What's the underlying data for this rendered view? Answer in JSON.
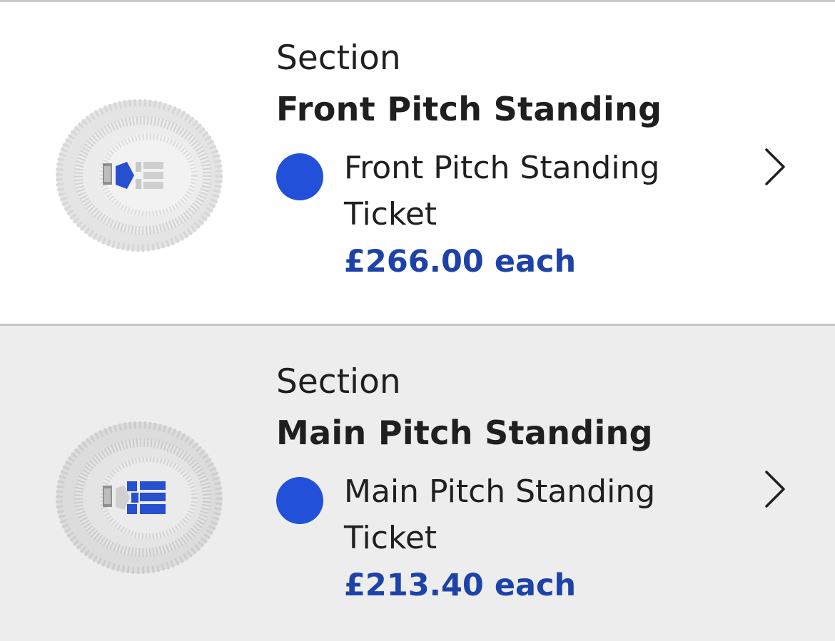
{
  "sections": [
    {
      "label": "Section",
      "name": "Front Pitch Standing",
      "ticket_name": "Front Pitch Standing Ticket",
      "price": "£266.00 each",
      "highlight": "front",
      "dot_color": "#2250d9",
      "price_color": "#1d43a8"
    },
    {
      "label": "Section",
      "name": "Main Pitch Standing",
      "ticket_name": "Main Pitch Standing Ticket",
      "price": "£213.40 each",
      "highlight": "main",
      "dot_color": "#2250d9",
      "price_color": "#1d43a8"
    }
  ],
  "icons": {
    "map": "stadium-map-icon",
    "chevron": "chevron-right-icon"
  }
}
